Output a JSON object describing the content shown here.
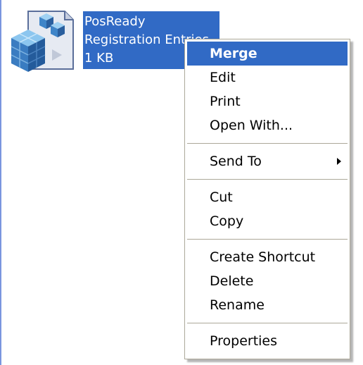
{
  "file": {
    "name": "PosReady",
    "type": "Registration Entries",
    "size": "1 KB"
  },
  "menu": {
    "merge": "Merge",
    "edit": "Edit",
    "print": "Print",
    "open_with": "Open With...",
    "send_to": "Send To",
    "cut": "Cut",
    "copy": "Copy",
    "create_shortcut": "Create Shortcut",
    "delete": "Delete",
    "rename": "Rename",
    "properties": "Properties"
  },
  "colors": {
    "selection": "#316ac5",
    "menu_border": "#aca899"
  },
  "icons": {
    "file_icon": "registry-file-icon",
    "submenu": "chevron-right-icon"
  }
}
